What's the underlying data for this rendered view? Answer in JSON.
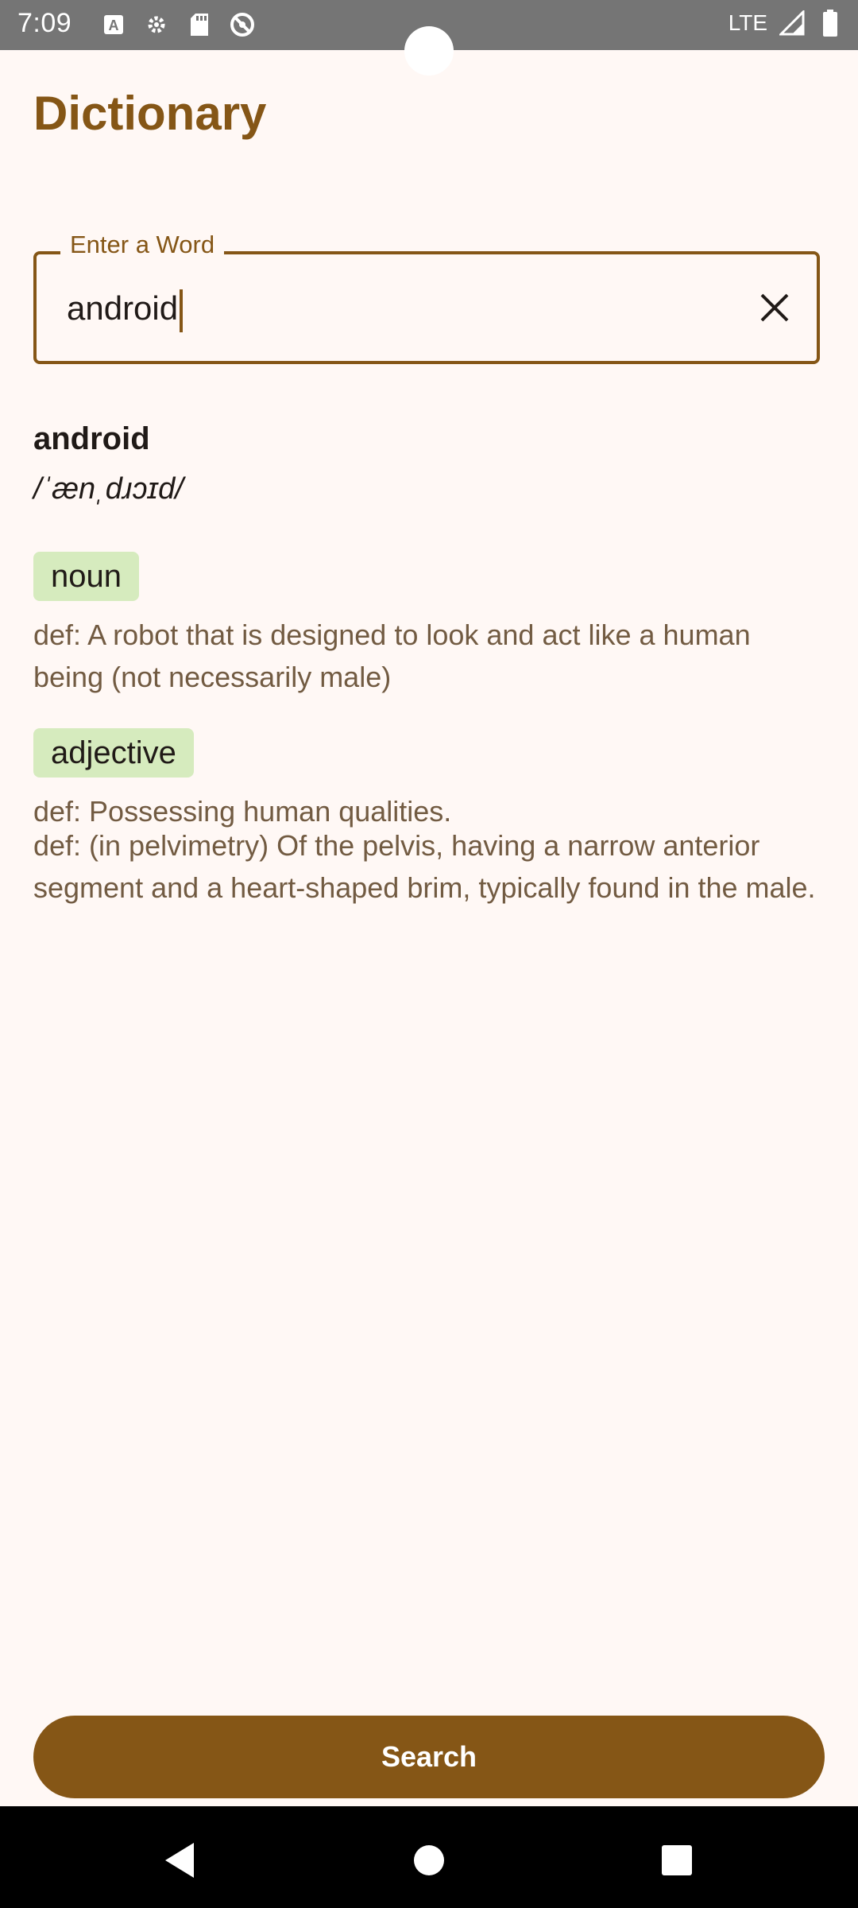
{
  "status_bar": {
    "time": "7:09",
    "network": "LTE",
    "icons": [
      "a-icon",
      "settings-icon",
      "sd-card-icon",
      "no-sync-icon",
      "signal-icon",
      "battery-icon"
    ]
  },
  "app": {
    "title": "Dictionary"
  },
  "search": {
    "label": "Enter a Word",
    "value": "android",
    "clear_icon": "close-icon",
    "button_label": "Search"
  },
  "result": {
    "word": "android",
    "phonetic": "/ˈænˌdɹɔɪd/",
    "meanings": [
      {
        "part_of_speech": "noun",
        "definitions": [
          "def: A robot that is designed to look and act like a human being (not necessarily male)"
        ]
      },
      {
        "part_of_speech": "adjective",
        "definitions": [
          "def: Possessing human qualities.",
          "def: (in pelvimetry) Of the pelvis, having a narrow anterior segment and a heart-shaped brim, typically found in the male."
        ]
      }
    ]
  },
  "colors": {
    "primary": "#855616",
    "background": "#fff8f5",
    "chip": "#d6ebbe",
    "definition_text": "#725b42"
  },
  "nav_bar": {
    "buttons": [
      "back-icon",
      "home-icon",
      "recents-icon"
    ]
  }
}
